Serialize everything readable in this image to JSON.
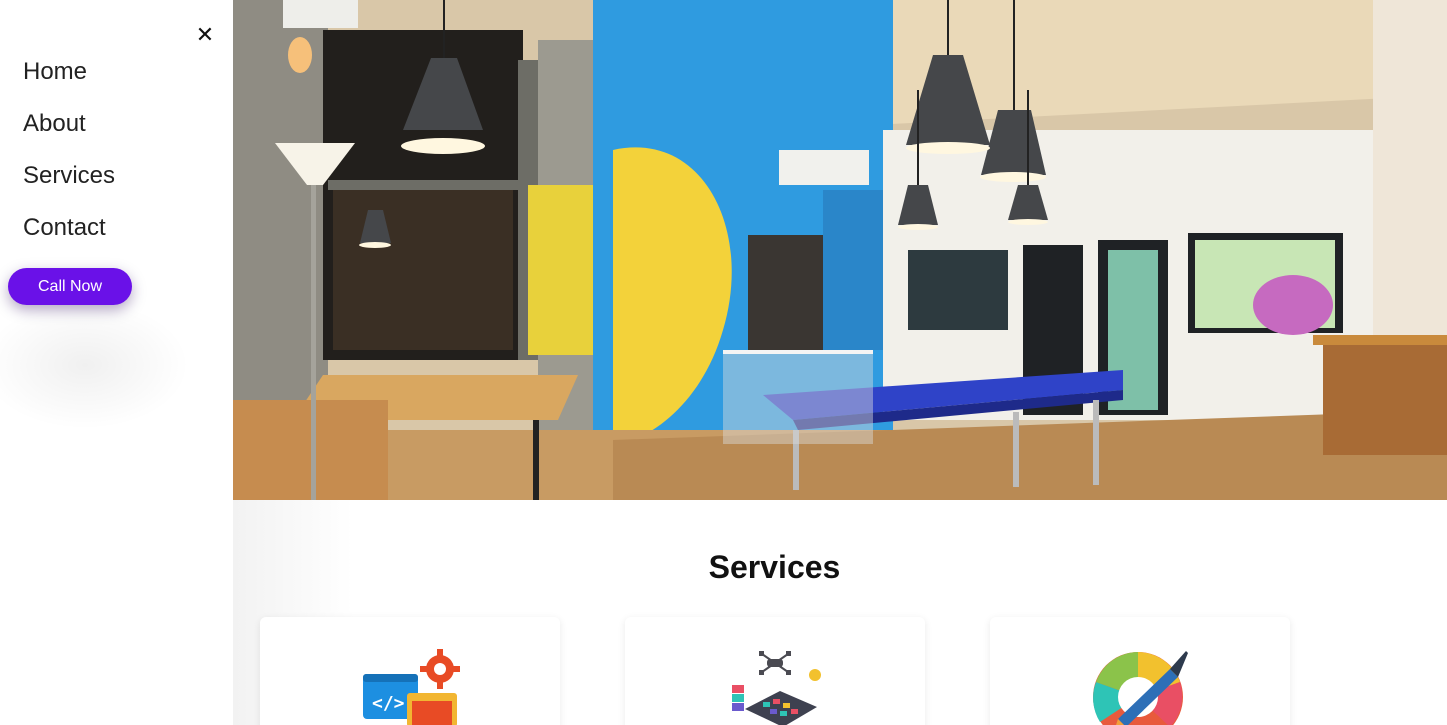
{
  "sidebar": {
    "close_symbol": "✕",
    "items": [
      {
        "label": "Home"
      },
      {
        "label": "About"
      },
      {
        "label": "Services"
      },
      {
        "label": "Contact"
      }
    ],
    "call_button": "Call Now"
  },
  "hero": {
    "icon": "office-photo"
  },
  "services": {
    "title": "Services",
    "cards": [
      {
        "icon": "web-development-icon"
      },
      {
        "icon": "app-development-icon"
      },
      {
        "icon": "graphic-design-icon"
      }
    ]
  },
  "colors": {
    "accent": "#6a11e8",
    "wall_blue": "#2f9be0",
    "wall_yellow": "#f3d23a"
  }
}
